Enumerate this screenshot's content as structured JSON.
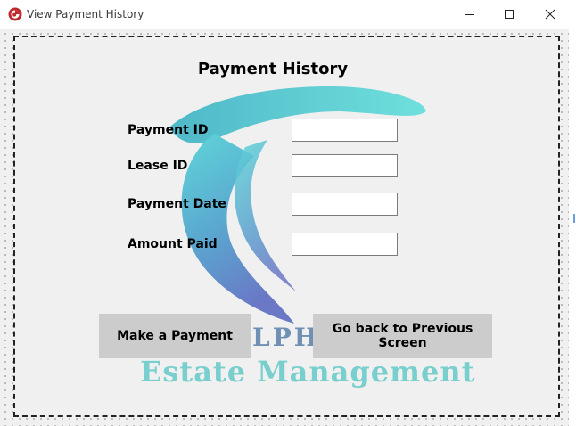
{
  "window": {
    "title": "View Payment History",
    "controls": [
      "minimize",
      "maximize",
      "close"
    ]
  },
  "form": {
    "heading": "Payment History",
    "fields": [
      {
        "label": "Payment ID",
        "value": "",
        "placeholder": ""
      },
      {
        "label": "Lease ID",
        "value": "",
        "placeholder": ""
      },
      {
        "label": "Payment Date",
        "value": "",
        "placeholder": ""
      },
      {
        "label": "Amount Paid",
        "value": "",
        "placeholder": ""
      }
    ]
  },
  "buttons": {
    "make_payment": "Make a Payment",
    "go_back": "Go back to Previous Screen"
  },
  "brand": {
    "partial_text": "LPH",
    "tagline": "Estate Management"
  },
  "colors": {
    "client_bg": "#f0f0f0",
    "button_bg": "#cccccc",
    "brand_teal": "#79cfcd",
    "logo_gradient_start": "#5fd3d8",
    "logo_gradient_end": "#6b7fc8"
  }
}
